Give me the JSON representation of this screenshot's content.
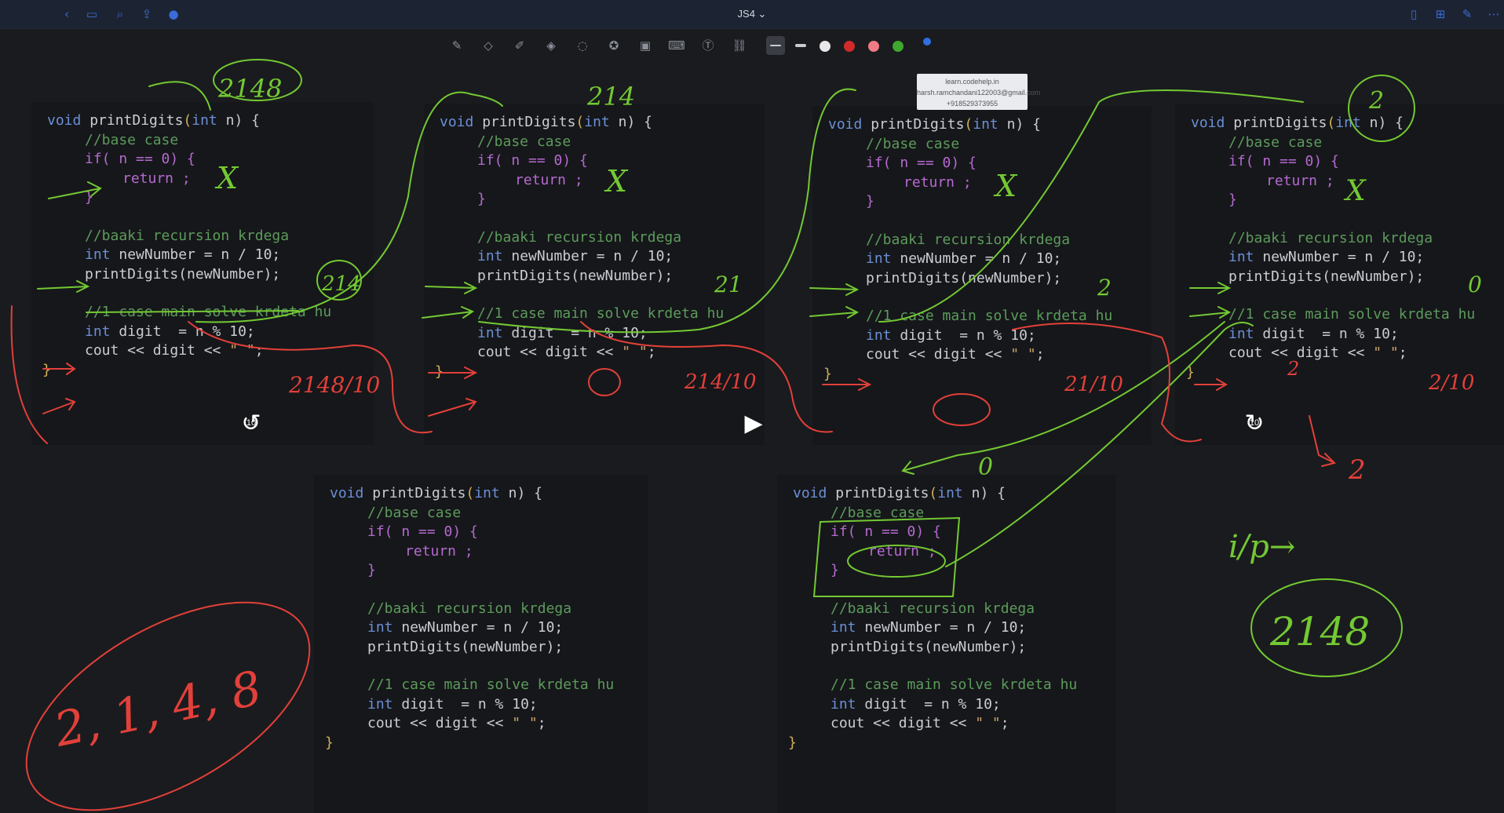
{
  "window": {
    "title": "JS4 ⌄"
  },
  "topbar_icons": [
    "back-icon",
    "sidebar-icon",
    "search-icon",
    "share-icon",
    "mic-icon"
  ],
  "topbar_right_icons": [
    "bookmark-icon",
    "add-page-icon",
    "pen-mode-icon",
    "more-icon"
  ],
  "toolbar": {
    "tools": [
      "pen-icon",
      "eraser-icon",
      "highlighter-icon",
      "shapes-icon",
      "lasso-icon",
      "sticker-icon",
      "image-icon",
      "keyboard-icon",
      "text-icon",
      "link-icon"
    ],
    "colors": [
      "#d12a2a",
      "#f07a85",
      "#3fa62e",
      "#2f6fe0"
    ]
  },
  "watermark": {
    "line1": "learn.codehelp.in",
    "line2": "harsh.ramchandani122003@gmail.com",
    "line3": "+918529373955"
  },
  "code": {
    "signature": [
      "void",
      " printDigits",
      "(",
      "int",
      " n) {"
    ],
    "base_comment": "//base case",
    "if_line": "if( n == 0) {",
    "return_line": "return ;",
    "close_brace": "}",
    "rec_comment": "//baaki recursion krdega",
    "newnum_line": [
      "int",
      " newNumber = n / 10;"
    ],
    "call_line": "printDigits(newNumber);",
    "case_comment": "//1 case main solve krdeta hu",
    "digit_line": [
      "int",
      " digit  = n % 10;"
    ],
    "cout_line": [
      "cout << digit << ",
      "\" \"",
      ";"
    ],
    "end_brace": "}"
  },
  "annotations": {
    "p1_arg": "2148",
    "p1_newnum": "214",
    "p1_digit": "2148/10",
    "p2_arg": "214",
    "p2_newnum": "21",
    "p2_digit": "214/10",
    "p3_newnum": "2",
    "p3_digit": "21/10",
    "p4_arg": "2",
    "p4_newnum": "0",
    "p4_digit": "2/10",
    "p4_out": "2",
    "p4_digit_val": "2",
    "p5_arg": "0",
    "io_label": "i/p→",
    "io_value": "2148",
    "output": "2, 1, 4, 8",
    "cross": "X"
  },
  "video": {
    "skip": "10"
  }
}
